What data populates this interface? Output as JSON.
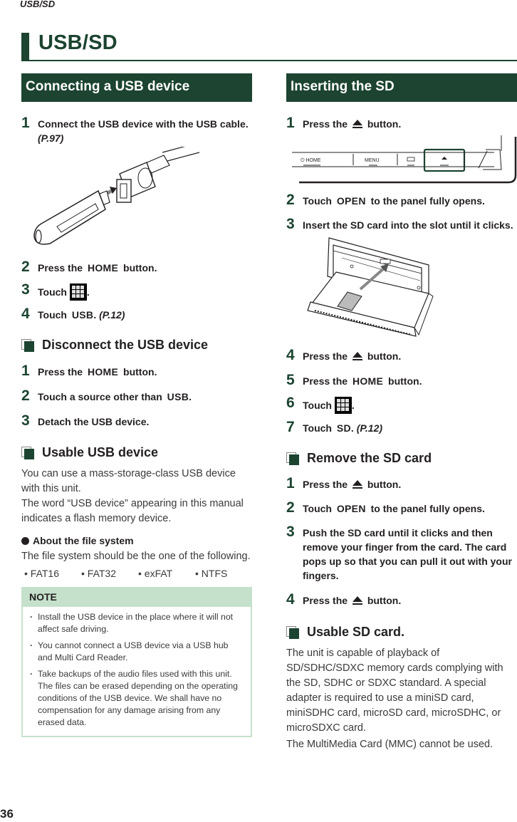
{
  "running_head": "USB/SD",
  "chapter_title": "USB/SD",
  "page_number": "36",
  "left": {
    "section_title": "Connecting a USB device",
    "connect_steps": [
      {
        "num": "1",
        "text": "Connect the USB device with the USB cable.",
        "ref": "(P.97)"
      },
      {
        "num": "2",
        "pre": "Press the",
        "keyword": "HOME",
        "post": "button."
      },
      {
        "num": "3",
        "pre": "Touch",
        "icon": "home-grid-icon",
        "post": "."
      },
      {
        "num": "4",
        "pre": "Touch",
        "keyword": "USB",
        "post": ".",
        "ref": "(P.12)"
      }
    ],
    "disconnect": {
      "title": "Disconnect the USB device",
      "steps": [
        {
          "num": "1",
          "pre": "Press the",
          "keyword": "HOME",
          "post": "button."
        },
        {
          "num": "2",
          "pre": "Touch a source other than",
          "keyword": "USB",
          "post": "."
        },
        {
          "num": "3",
          "text": "Detach the USB device."
        }
      ]
    },
    "usable": {
      "title": "Usable USB device",
      "paragraphs": [
        "You can use a mass-storage-class USB device with this unit.",
        "The word “USB device” appearing in this manual indicates a flash memory device."
      ],
      "file_system_heading": "About the file system",
      "file_system_text": "The file system should be the one of the following.",
      "file_systems": [
        "• FAT16",
        "• FAT32",
        "• exFAT",
        "• NTFS"
      ]
    },
    "note": {
      "heading": "NOTE",
      "items": [
        "Install the USB device in the place where it will not affect safe driving.",
        "You cannot connect a USB device via a USB hub and Multi Card Reader.",
        "Take backups of the audio files used with this unit. The files can be erased depending on the operating conditions of the USB device. We shall have no compensation for any damage arising from any erased data."
      ]
    }
  },
  "right": {
    "section_title": "Inserting the SD",
    "insert_steps": [
      {
        "num": "1",
        "pre": "Press the",
        "icon": "eject-icon",
        "post": "button."
      },
      {
        "num": "2",
        "pre": "Touch",
        "keyword": "OPEN",
        "post": "to the panel fully opens."
      },
      {
        "num": "3",
        "text": "Insert the SD card into the slot until it clicks."
      },
      {
        "num": "4",
        "pre": "Press the",
        "icon": "eject-icon",
        "post": "button."
      },
      {
        "num": "5",
        "pre": "Press the",
        "keyword": "HOME",
        "post": "button."
      },
      {
        "num": "6",
        "pre": "Touch",
        "icon": "home-grid-icon",
        "post": "."
      },
      {
        "num": "7",
        "pre": "Touch",
        "keyword": "SD",
        "post": ".",
        "ref": "(P.12)"
      }
    ],
    "panel_buttons": [
      "HOME",
      "MENU",
      "",
      "▲"
    ],
    "remove": {
      "title": "Remove the SD card",
      "steps": [
        {
          "num": "1",
          "pre": "Press the",
          "icon": "eject-icon",
          "post": "button."
        },
        {
          "num": "2",
          "pre": "Touch",
          "keyword": "OPEN",
          "post": "to the panel fully opens."
        },
        {
          "num": "3",
          "text": "Push the SD card until it clicks and then remove your finger from the card. The card pops up so that you can pull it out with your fingers."
        },
        {
          "num": "4",
          "pre": "Press the",
          "icon": "eject-icon",
          "post": "button."
        }
      ]
    },
    "usable_sd": {
      "title": "Usable SD card.",
      "paragraphs": [
        "The unit is capable of playback of SD/SDHC/SDXC memory cards complying with the SD, SDHC or SDXC standard. A special adapter is required to use a miniSD card, miniSDHC card, microSD card, microSDHC, or microSDXC card.",
        "The MultiMedia Card (MMC) cannot be used."
      ]
    }
  },
  "colors": {
    "brand_green": "#1c4430",
    "note_green": "#c6e1cb",
    "text": "#231f20"
  }
}
